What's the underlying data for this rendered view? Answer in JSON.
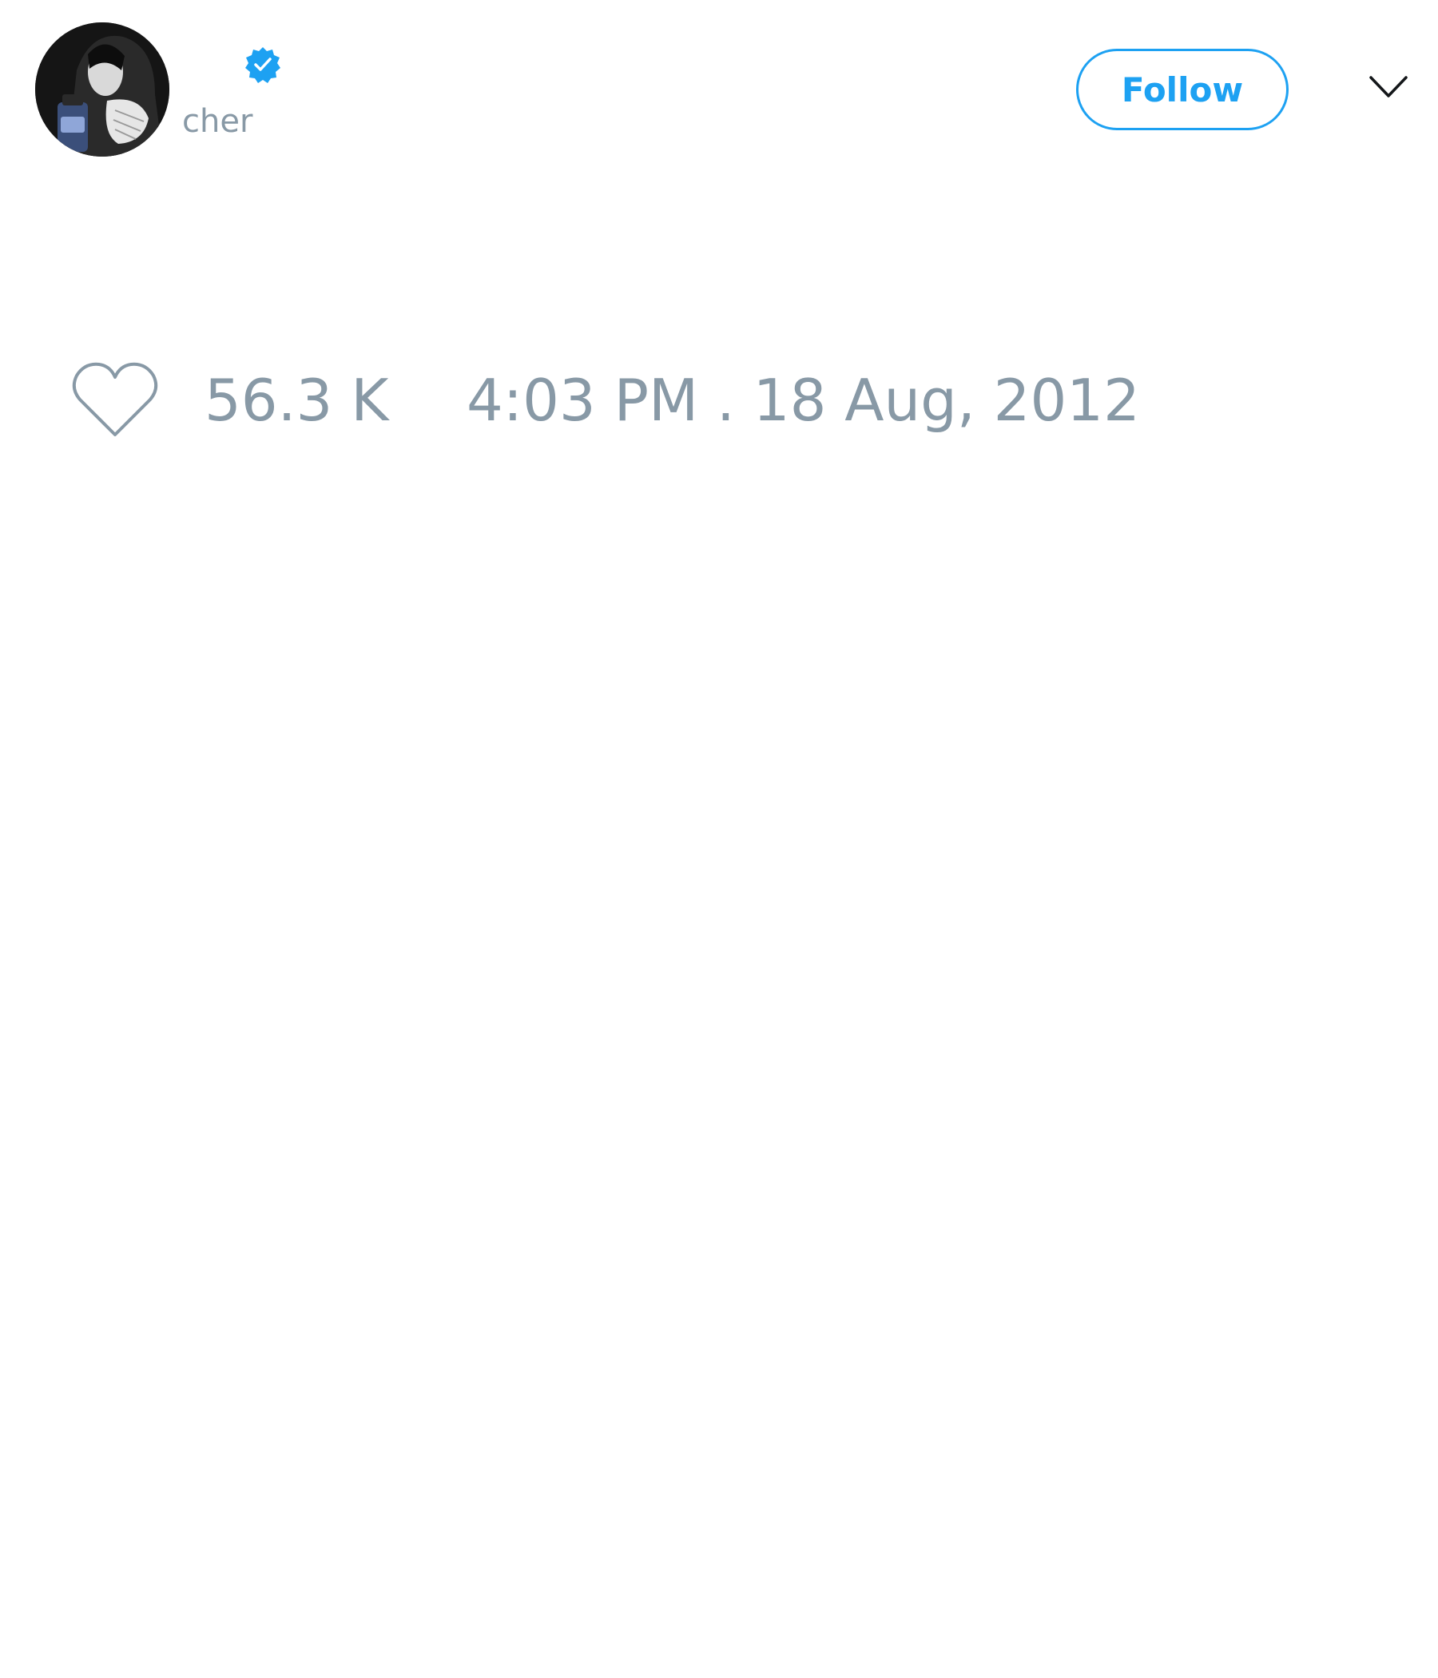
{
  "profile": {
    "handle": "cher",
    "verified": true,
    "avatar_icon": "profile-photo"
  },
  "header": {
    "follow_label": "Follow",
    "menu_icon": "chevron-down-icon"
  },
  "stats": {
    "like_icon": "heart-outline-icon",
    "likes": "56.3 K",
    "timestamp": "4:03 PM . 18 Aug, 2012"
  },
  "colors": {
    "accent": "#1da1f2",
    "muted_text": "#8899a6",
    "background": "#ffffff"
  }
}
